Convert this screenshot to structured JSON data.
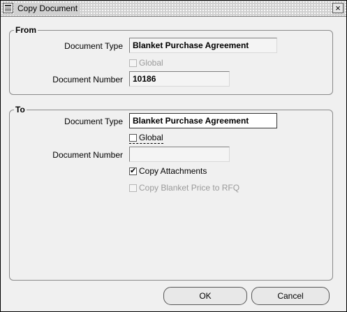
{
  "window": {
    "title": "Copy Document"
  },
  "from": {
    "group_title": "From",
    "document_type_label": "Document Type",
    "document_type_value": "Blanket Purchase Agreement",
    "global_label": "Global",
    "global_checked": false,
    "document_number_label": "Document Number",
    "document_number_value": "10186"
  },
  "to": {
    "group_title": "To",
    "document_type_label": "Document Type",
    "document_type_value": "Blanket Purchase Agreement",
    "global_label": "Global",
    "global_checked": false,
    "document_number_label": "Document Number",
    "document_number_value": "",
    "copy_attachments_label": "Copy Attachments",
    "copy_attachments_checked": true,
    "copy_blanket_price_label": "Copy Blanket Price to RFQ",
    "copy_blanket_price_checked": false
  },
  "buttons": {
    "ok": "OK",
    "cancel": "Cancel"
  },
  "icons": {
    "app": "window-app-icon",
    "close": "close-icon",
    "check": "checkmark-icon"
  }
}
